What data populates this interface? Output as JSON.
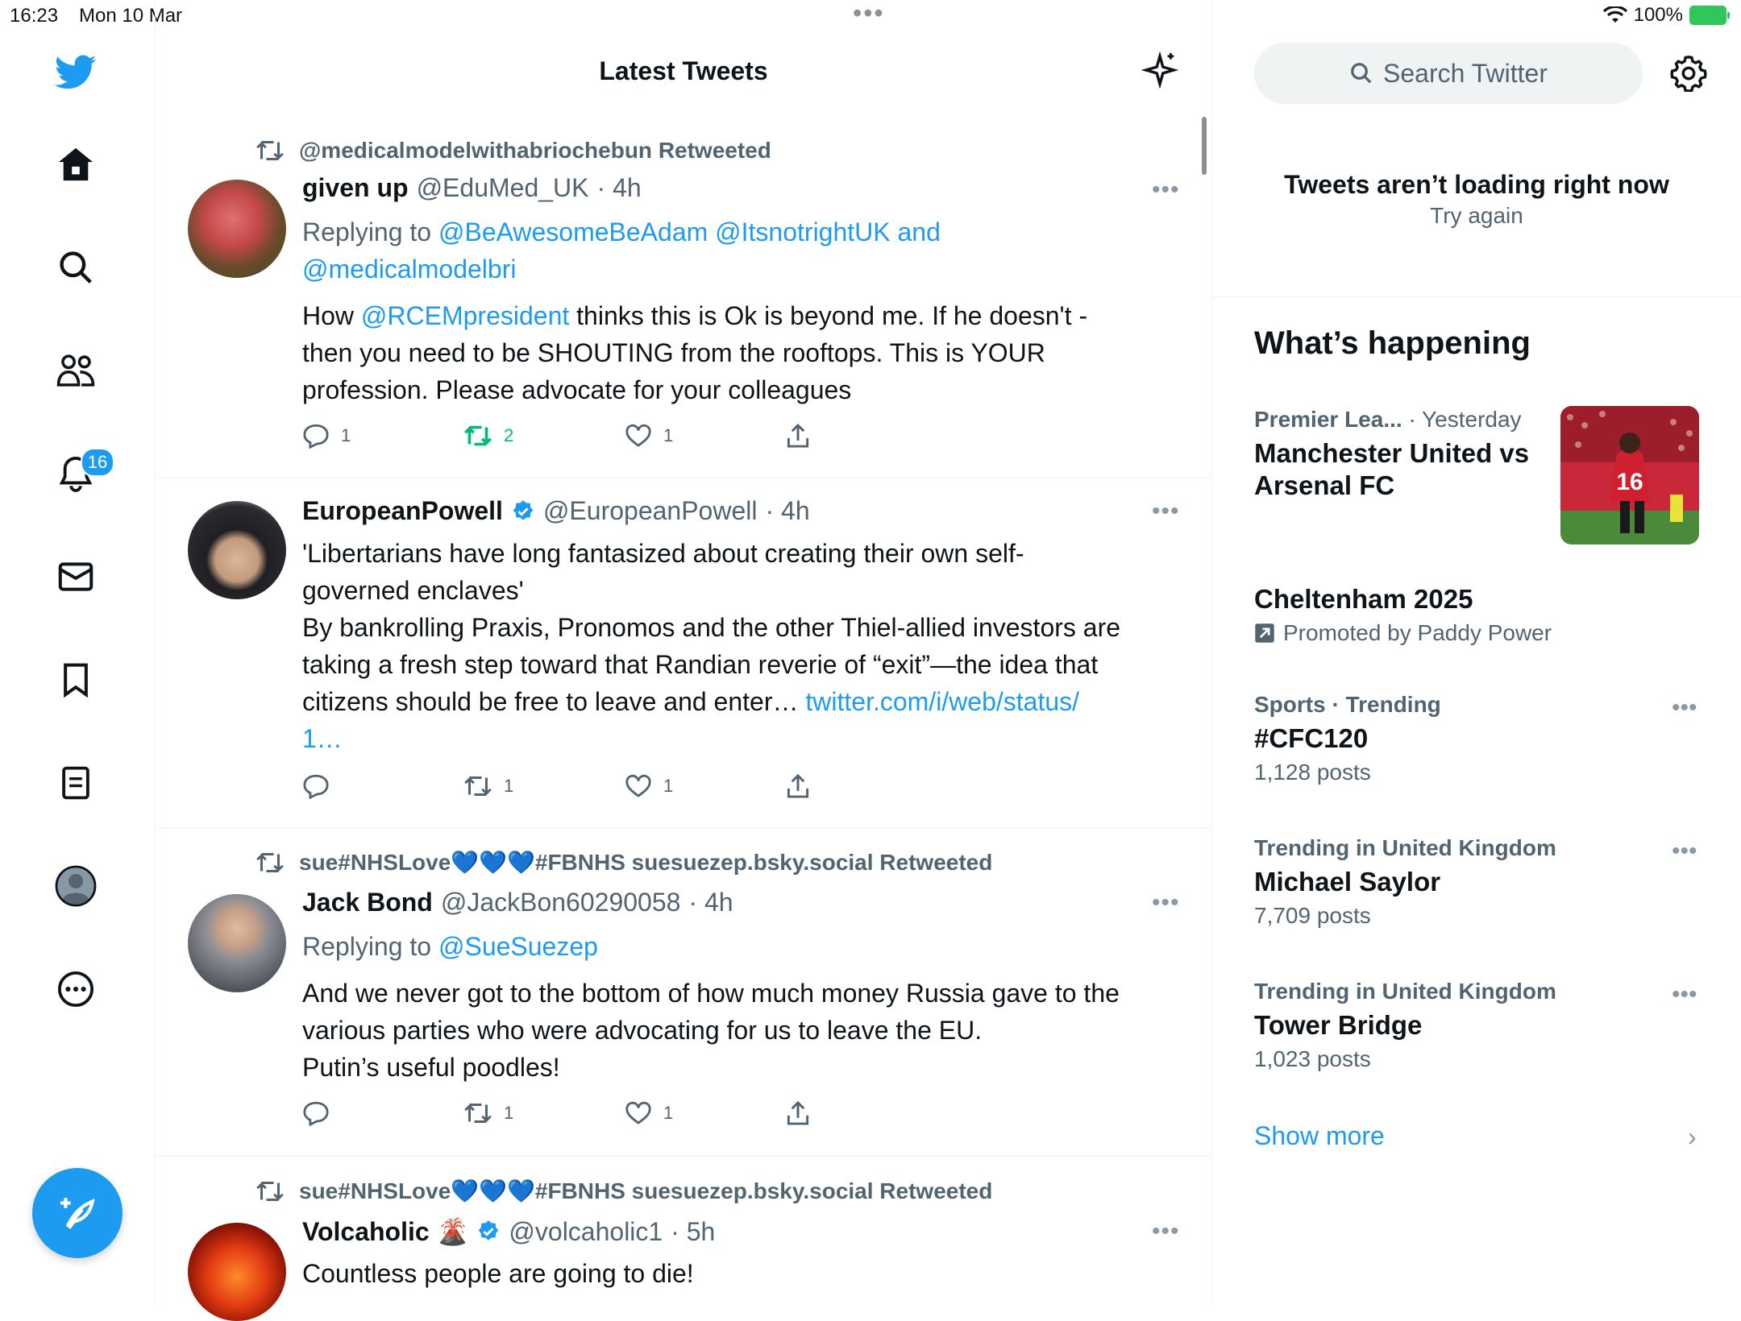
{
  "status_bar": {
    "time": "16:23",
    "date": "Mon 10 Mar",
    "battery_pct": "100%"
  },
  "nav": {
    "notifications_badge": "16",
    "icons": [
      "twitter-logo",
      "home-icon",
      "search-icon",
      "communities-icon",
      "notifications-icon",
      "messages-icon",
      "bookmarks-icon",
      "lists-icon",
      "profile-icon",
      "more-icon",
      "compose-icon"
    ]
  },
  "feed": {
    "title": "Latest Tweets",
    "tweets": [
      {
        "retweeted_by": "@medicalmodelwithabriochebun Retweeted",
        "name": "given up",
        "handle": "@EduMed_UK",
        "time": "· 4h",
        "reply_prefix": "Replying to",
        "reply_to_1": "@BeAwesomeBeAdam @ItsnotrightUK and",
        "reply_to_2": "@medicalmodelbri",
        "text_a": "How",
        "mention": "@RCEMpresident",
        "text_b": "thinks this is Ok is beyond me. If he doesn't -",
        "line2": "then you need to be SHOUTING from the rooftops. This is YOUR",
        "line3": "profession. Please advocate for your colleagues",
        "replies": "1",
        "retweets": "2",
        "likes": "1"
      },
      {
        "name": "EuropeanPowell",
        "handle": "@EuropeanPowell",
        "time": "· 4h",
        "line1": "'Libertarians have long fantasized about creating their own self-",
        "line2": "governed enclaves'",
        "line3": "By bankrolling Praxis, Pronomos and the other Thiel-allied investors are",
        "line4": "taking a fresh step toward that Randian reverie of “exit”—the idea that",
        "line5": "citizens should be free to leave and enter…",
        "link1": "twitter.com/i/web/status/",
        "link2": "1…",
        "replies": "",
        "retweets": "1",
        "likes": "1"
      },
      {
        "retweeted_by": "sue#NHSLove💙💙💙#FBNHS suesuezep.bsky.social Retweeted",
        "name": "Jack Bond",
        "handle": "@JackBon60290058",
        "time": "· 4h",
        "reply_prefix": "Replying to",
        "reply_to_1": "@SueSuezep",
        "line1": "And we never got to the bottom of how much money Russia gave to the",
        "line2": "various parties who were advocating for us to leave the EU.",
        "line3": "Putin’s useful poodles!",
        "replies": "",
        "retweets": "1",
        "likes": "1"
      },
      {
        "retweeted_by": "sue#NHSLove💙💙💙#FBNHS suesuezep.bsky.social Retweeted",
        "name": "Volcaholic 🌋",
        "handle": "@volcaholic1",
        "time": "· 5h",
        "line1": "Countless people are going to die!"
      }
    ]
  },
  "right": {
    "search_placeholder": "Search Twitter",
    "error_title": "Tweets aren’t loading right now",
    "error_retry": "Try again",
    "whats_happening": "What’s happening",
    "trends": [
      {
        "category": "Premier Lea...",
        "when": "· Yesterday",
        "title_1": "Manchester United vs",
        "title_2": "Arsenal FC",
        "image_jersey": "16"
      },
      {
        "title": "Cheltenham 2025",
        "promoted": "Promoted by Paddy Power"
      },
      {
        "category": "Sports · Trending",
        "title": "#CFC120",
        "count": "1,128 posts"
      },
      {
        "category": "Trending in United Kingdom",
        "title": "Michael Saylor",
        "count": "7,709 posts"
      },
      {
        "category": "Trending in United Kingdom",
        "title": "Tower Bridge",
        "count": "1,023 posts"
      }
    ],
    "show_more": "Show more"
  },
  "colors": {
    "accent": "#1d9bf0",
    "retweet_green": "#00ba7c",
    "secondary_text": "#536471",
    "battery_green": "#31c659"
  }
}
